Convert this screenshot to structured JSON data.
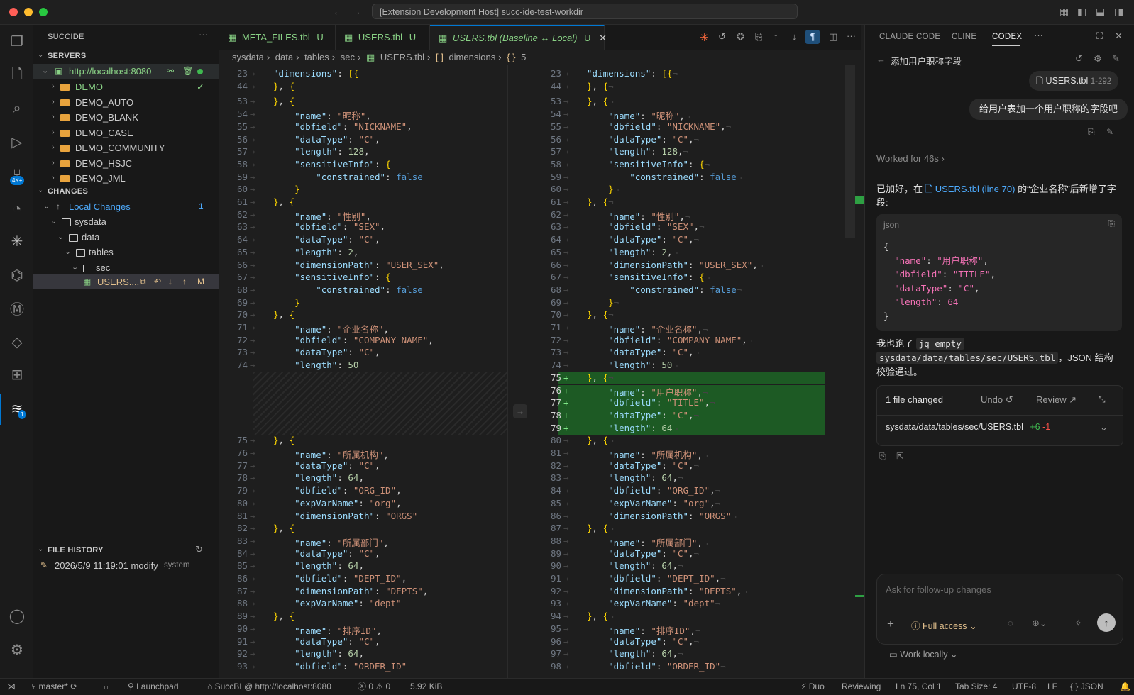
{
  "window": {
    "title": "[Extension Development Host] succ-ide-test-workdir"
  },
  "sidebar": {
    "header": "SUCCIDE",
    "servers_title": "SERVERS",
    "server_url": "http://localhost:8080",
    "server_items": [
      "DEMO",
      "DEMO_AUTO",
      "DEMO_BLANK",
      "DEMO_CASE",
      "DEMO_COMMUNITY",
      "DEMO_HSJC",
      "DEMO_JML"
    ],
    "changes_title": "CHANGES",
    "local_changes": "Local Changes",
    "local_changes_count": "1",
    "tree": [
      "sysdata",
      "data",
      "tables",
      "sec"
    ],
    "changed_file": "USERS....",
    "changed_file_status": "M",
    "history_title": "FILE HISTORY",
    "history_entry": "2026/5/9 11:19:01 modify",
    "history_user": "system"
  },
  "activity": {
    "badge_source": "4K+",
    "badge_succ": "1"
  },
  "tabs": [
    {
      "label": "META_FILES.tbl",
      "status": "U"
    },
    {
      "label": "USERS.tbl",
      "status": "U"
    },
    {
      "label": "USERS.tbl (Baseline ↔ Local)",
      "status": "U"
    }
  ],
  "breadcrumb": [
    "sysdata",
    "data",
    "tables",
    "sec",
    "USERS.tbl",
    "dimensions",
    "5"
  ],
  "diff": {
    "left": [
      {
        "n": "23",
        "t": "\"dimensions\": [{"
      },
      {
        "n": "44",
        "t": "}, {"
      },
      {
        "n": "53",
        "t": "}, {"
      },
      {
        "n": "54",
        "t": "    \"name\": \"昵称\","
      },
      {
        "n": "55",
        "t": "    \"dbfield\": \"NICKNAME\","
      },
      {
        "n": "56",
        "t": "    \"dataType\": \"C\","
      },
      {
        "n": "57",
        "t": "    \"length\": 128,"
      },
      {
        "n": "58",
        "t": "    \"sensitiveInfo\": {"
      },
      {
        "n": "59",
        "t": "        \"constrained\": false"
      },
      {
        "n": "60",
        "t": "    }"
      },
      {
        "n": "61",
        "t": "}, {"
      },
      {
        "n": "62",
        "t": "    \"name\": \"性别\","
      },
      {
        "n": "63",
        "t": "    \"dbfield\": \"SEX\","
      },
      {
        "n": "64",
        "t": "    \"dataType\": \"C\","
      },
      {
        "n": "65",
        "t": "    \"length\": 2,"
      },
      {
        "n": "66",
        "t": "    \"dimensionPath\": \"USER_SEX\","
      },
      {
        "n": "67",
        "t": "    \"sensitiveInfo\": {"
      },
      {
        "n": "68",
        "t": "        \"constrained\": false"
      },
      {
        "n": "69",
        "t": "    }"
      },
      {
        "n": "70",
        "t": "}, {"
      },
      {
        "n": "71",
        "t": "    \"name\": \"企业名称\","
      },
      {
        "n": "72",
        "t": "    \"dbfield\": \"COMPANY_NAME\","
      },
      {
        "n": "73",
        "t": "    \"dataType\": \"C\","
      },
      {
        "n": "74",
        "t": "    \"length\": 50"
      },
      {
        "n": "75",
        "t": "}, {"
      },
      {
        "n": "76",
        "t": "    \"name\": \"所属机构\","
      },
      {
        "n": "77",
        "t": "    \"dataType\": \"C\","
      },
      {
        "n": "78",
        "t": "    \"length\": 64,"
      },
      {
        "n": "79",
        "t": "    \"dbfield\": \"ORG_ID\","
      },
      {
        "n": "80",
        "t": "    \"expVarName\": \"org\","
      },
      {
        "n": "81",
        "t": "    \"dimensionPath\": \"ORGS\""
      },
      {
        "n": "82",
        "t": "}, {"
      },
      {
        "n": "83",
        "t": "    \"name\": \"所属部门\","
      },
      {
        "n": "84",
        "t": "    \"dataType\": \"C\","
      },
      {
        "n": "85",
        "t": "    \"length\": 64,"
      },
      {
        "n": "86",
        "t": "    \"dbfield\": \"DEPT_ID\","
      },
      {
        "n": "87",
        "t": "    \"dimensionPath\": \"DEPTS\","
      },
      {
        "n": "88",
        "t": "    \"expVarName\": \"dept\""
      },
      {
        "n": "89",
        "t": "}, {"
      },
      {
        "n": "90",
        "t": "    \"name\": \"排序ID\","
      },
      {
        "n": "91",
        "t": "    \"dataType\": \"C\","
      },
      {
        "n": "92",
        "t": "    \"length\": 64,"
      },
      {
        "n": "93",
        "t": "    \"dbfield\": \"ORDER_ID\""
      }
    ],
    "right": [
      {
        "n": "23",
        "t": "\"dimensions\": [{"
      },
      {
        "n": "44",
        "t": "}, {"
      },
      {
        "n": "53",
        "t": "}, {"
      },
      {
        "n": "54",
        "t": "    \"name\": \"昵称\","
      },
      {
        "n": "55",
        "t": "    \"dbfield\": \"NICKNAME\","
      },
      {
        "n": "56",
        "t": "    \"dataType\": \"C\","
      },
      {
        "n": "57",
        "t": "    \"length\": 128,"
      },
      {
        "n": "58",
        "t": "    \"sensitiveInfo\": {"
      },
      {
        "n": "59",
        "t": "        \"constrained\": false"
      },
      {
        "n": "60",
        "t": "    }"
      },
      {
        "n": "61",
        "t": "}, {"
      },
      {
        "n": "62",
        "t": "    \"name\": \"性别\","
      },
      {
        "n": "63",
        "t": "    \"dbfield\": \"SEX\","
      },
      {
        "n": "64",
        "t": "    \"dataType\": \"C\","
      },
      {
        "n": "65",
        "t": "    \"length\": 2,"
      },
      {
        "n": "66",
        "t": "    \"dimensionPath\": \"USER_SEX\","
      },
      {
        "n": "67",
        "t": "    \"sensitiveInfo\": {"
      },
      {
        "n": "68",
        "t": "        \"constrained\": false"
      },
      {
        "n": "69",
        "t": "    }"
      },
      {
        "n": "70",
        "t": "}, {"
      },
      {
        "n": "71",
        "t": "    \"name\": \"企业名称\","
      },
      {
        "n": "72",
        "t": "    \"dbfield\": \"COMPANY_NAME\","
      },
      {
        "n": "73",
        "t": "    \"dataType\": \"C\","
      },
      {
        "n": "74",
        "t": "    \"length\": 50"
      },
      {
        "n": "75",
        "t": "}, {",
        "added": true
      },
      {
        "n": "76",
        "t": "    \"name\": \"用户职称\",",
        "added": true
      },
      {
        "n": "77",
        "t": "    \"dbfield\": \"TITLE\",",
        "added": true
      },
      {
        "n": "78",
        "t": "    \"dataType\": \"C\",",
        "added": true
      },
      {
        "n": "79",
        "t": "    \"length\": 64",
        "added": true
      },
      {
        "n": "80",
        "t": "}, {"
      },
      {
        "n": "81",
        "t": "    \"name\": \"所属机构\","
      },
      {
        "n": "82",
        "t": "    \"dataType\": \"C\","
      },
      {
        "n": "83",
        "t": "    \"length\": 64,"
      },
      {
        "n": "84",
        "t": "    \"dbfield\": \"ORG_ID\","
      },
      {
        "n": "85",
        "t": "    \"expVarName\": \"org\","
      },
      {
        "n": "86",
        "t": "    \"dimensionPath\": \"ORGS\""
      },
      {
        "n": "87",
        "t": "}, {"
      },
      {
        "n": "88",
        "t": "    \"name\": \"所属部门\","
      },
      {
        "n": "89",
        "t": "    \"dataType\": \"C\","
      },
      {
        "n": "90",
        "t": "    \"length\": 64,"
      },
      {
        "n": "91",
        "t": "    \"dbfield\": \"DEPT_ID\","
      },
      {
        "n": "92",
        "t": "    \"dimensionPath\": \"DEPTS\","
      },
      {
        "n": "93",
        "t": "    \"expVarName\": \"dept\""
      },
      {
        "n": "94",
        "t": "}, {"
      },
      {
        "n": "95",
        "t": "    \"name\": \"排序ID\","
      },
      {
        "n": "96",
        "t": "    \"dataType\": \"C\","
      },
      {
        "n": "97",
        "t": "    \"length\": 64,"
      },
      {
        "n": "98",
        "t": "    \"dbfield\": \"ORDER_ID\""
      }
    ]
  },
  "panel": {
    "tabs": [
      "CLAUDE CODE",
      "CLINE",
      "CODEX"
    ],
    "thread_title": "添加用户职称字段",
    "file_chip": "USERS.tbl",
    "file_range": "1-292",
    "user_message": "给用户表加一个用户职称的字段吧",
    "worked_for": "Worked for 46s",
    "reply_prefix": "已加好，在",
    "reply_link": "USERS.tbl (line 70)",
    "reply_suffix": "的“企业名称”后新增了字段:",
    "json_lang": "json",
    "json_lines": [
      "{",
      "  \"name\": \"用户职称\",",
      "  \"dbfield\": \"TITLE\",",
      "  \"dataType\": \"C\",",
      "  \"length\": 64",
      "}"
    ],
    "ran_prefix": "我也跑了",
    "ran_cmd1": "jq empty",
    "ran_cmd2": "sysdata/data/tables/sec/USERS.tbl",
    "ran_suffix": "，JSON 结构校验通过。",
    "files_changed": "1 file changed",
    "undo": "Undo",
    "review": "Review",
    "changed_path": "sysdata/data/tables/sec/USERS.tbl",
    "plus": "+6",
    "minus": "-1",
    "input_placeholder": "Ask for follow-up changes",
    "access": "Full access",
    "work_locally": "Work locally"
  },
  "status": {
    "branch": "master*",
    "launchpad": "Launchpad",
    "server": "SuccBI @ http://localhost:8080",
    "errors": "0",
    "warnings": "0",
    "size": "5.92 KiB",
    "duo": "Duo",
    "reviewing": "Reviewing",
    "position": "Ln 75, Col 1",
    "tabsize": "Tab Size: 4",
    "encoding": "UTF-8",
    "eol": "LF",
    "lang": "JSON"
  }
}
